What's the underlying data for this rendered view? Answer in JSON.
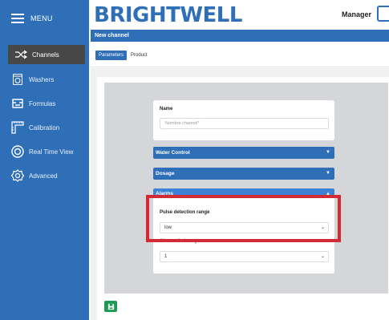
{
  "sidebar": {
    "menu_label": "MENU",
    "items": [
      {
        "label": "Channels",
        "icon": "channels-icon",
        "active": true
      },
      {
        "label": "Washers",
        "icon": "washer-icon"
      },
      {
        "label": "Formulas",
        "icon": "formulas-icon"
      },
      {
        "label": "Calibration",
        "icon": "calibration-icon"
      },
      {
        "label": "Real Time View",
        "icon": "realtime-icon"
      },
      {
        "label": "Advanced",
        "icon": "gear-icon"
      }
    ]
  },
  "header": {
    "brand": "BRIGHTWELL",
    "user": "Manager"
  },
  "page": {
    "title": "New channel",
    "tabs": [
      "Parameters",
      "Product"
    ]
  },
  "form": {
    "name_label": "Name",
    "name_placeholder": "Nombre channel*",
    "sections": [
      "Water Control",
      "Dosage",
      "Alarms"
    ],
    "pulse_label": "Pulse detection range",
    "pulse_value": "low",
    "second_label": "Alarma de la espera",
    "second_value": "1"
  },
  "colors": {
    "primary": "#2f6fb8",
    "highlight": "#d42a35",
    "save": "#1f9a55"
  }
}
